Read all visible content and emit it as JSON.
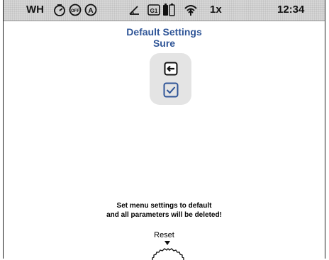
{
  "status_bar": {
    "mode": "WH",
    "icons": [
      "timer-icon",
      "clock-off-icon",
      "auto-icon",
      "angle-icon",
      "g1-icon",
      "battery-icon",
      "wifi-icon"
    ],
    "zoom": "1x",
    "time": "12:34"
  },
  "header": {
    "title": "Default Settings",
    "subtitle": "Sure"
  },
  "panel": {
    "buttons": [
      "back-icon",
      "confirm-checkbox-icon"
    ]
  },
  "message": {
    "line1": "Set menu settings to default",
    "line2": "and all parameters will be deleted!"
  },
  "reset": {
    "label": "Reset"
  },
  "colors": {
    "accent": "#2f5597",
    "statusbar": "#d6d6d6",
    "panel": "#e4e4e4"
  }
}
